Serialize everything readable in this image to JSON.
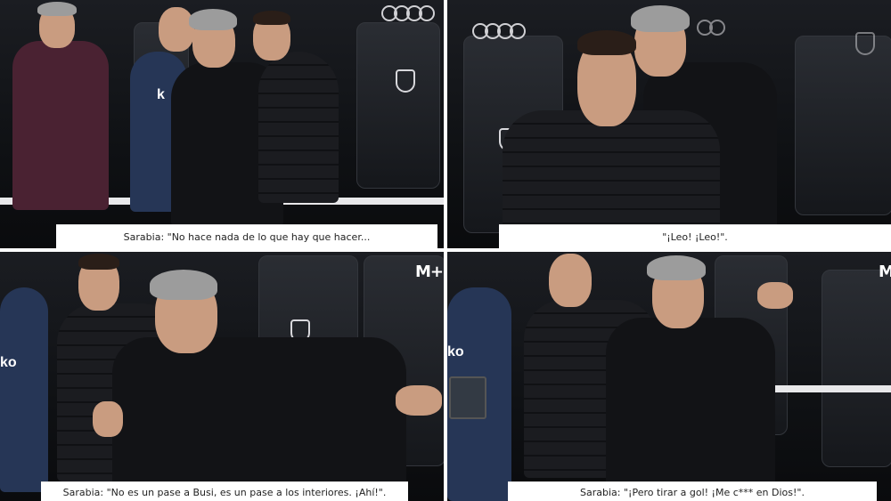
{
  "panels": [
    {
      "caption": "Sarabia: \"No hace nada de lo que hay que hacer..."
    },
    {
      "caption": "\"¡Leo! ¡Leo!\"."
    },
    {
      "caption": "Sarabia: \"No es un pase a Busi, es un pase a los interiores. ¡Ahí!\".",
      "logo": "M+"
    },
    {
      "caption": "Sarabia: \"¡Pero tirar a gol! ¡Me c*** en Dios!\".",
      "logo": "M"
    }
  ],
  "jersey_text": [
    "k",
    "ko",
    "ko"
  ]
}
